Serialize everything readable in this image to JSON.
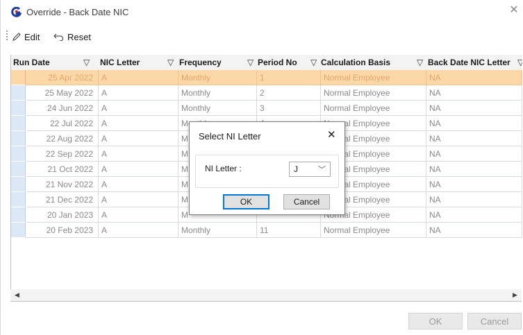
{
  "window": {
    "title": "Override - Back Date NIC",
    "close_glyph": "✕",
    "colors": {
      "accent": "#0078d7",
      "selected_row": "#fcd7a8"
    }
  },
  "toolbar": {
    "edit_label": "Edit",
    "reset_label": "Reset"
  },
  "grid": {
    "columns": [
      "Run Date",
      "NIC Letter",
      "Frequency",
      "Period No",
      "Calculation Basis",
      "Back Date NIC Letter"
    ],
    "rows": [
      [
        "25 Apr 2022",
        "A",
        "Monthly",
        "1",
        "Normal Employee",
        "NA"
      ],
      [
        "25 May 2022",
        "A",
        "Monthly",
        "2",
        "Normal Employee",
        "NA"
      ],
      [
        "24 Jun 2022",
        "A",
        "Monthly",
        "3",
        "Normal Employee",
        "NA"
      ],
      [
        "22 Jul 2022",
        "A",
        "Monthly",
        "4",
        "Normal Employee",
        "NA"
      ],
      [
        "22 Aug 2022",
        "A",
        "M",
        "",
        "Normal Employee",
        "NA"
      ],
      [
        "22 Sep 2022",
        "A",
        "M",
        "",
        "Normal Employee",
        "NA"
      ],
      [
        "21 Oct 2022",
        "A",
        "M",
        "",
        "Normal Employee",
        "NA"
      ],
      [
        "21 Nov 2022",
        "A",
        "M",
        "",
        "Normal Employee",
        "NA"
      ],
      [
        "21 Dec 2022",
        "A",
        "M",
        "",
        "Normal Employee",
        "NA"
      ],
      [
        "20 Jan 2023",
        "A",
        "M",
        "",
        "Normal Employee",
        "NA"
      ],
      [
        "20 Feb 2023",
        "A",
        "Monthly",
        "11",
        "Normal Employee",
        "NA"
      ]
    ],
    "selected_row": 0
  },
  "footer": {
    "ok_label": "OK",
    "cancel_label": "Cancel"
  },
  "dialog": {
    "title": "Select NI Letter",
    "close_glyph": "✕",
    "field_label": "NI Letter :",
    "field_value": "J",
    "ok_label": "OK",
    "cancel_label": "Cancel"
  }
}
